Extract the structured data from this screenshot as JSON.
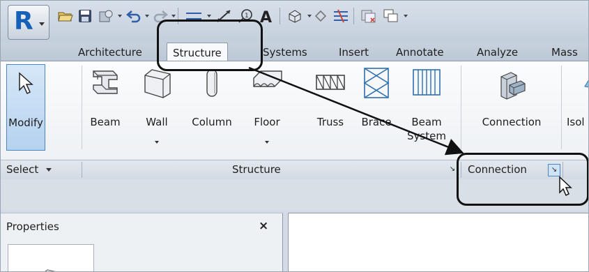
{
  "app": {
    "logo_letter": "R"
  },
  "quick_access": {
    "icons": [
      "open-icon",
      "save-icon",
      "sync-icon",
      "undo-icon",
      "redo-icon",
      "measure-icon",
      "dimension-icon",
      "tag-icon",
      "text-icon",
      "3d-view-icon",
      "section-icon",
      "thin-lines-icon",
      "close-hidden-icon",
      "switch-windows-icon"
    ]
  },
  "tabs": [
    {
      "label": "Architecture"
    },
    {
      "label": "Structure",
      "active": true
    },
    {
      "label": "Systems"
    },
    {
      "label": "Insert"
    },
    {
      "label": "Annotate"
    },
    {
      "label": "Analyze"
    },
    {
      "label": "Mass"
    }
  ],
  "ribbon": {
    "select_panel": {
      "modify_label": "Modify"
    },
    "structure_panel": {
      "beam": "Beam",
      "wall": "Wall",
      "column": "Column",
      "floor": "Floor",
      "truss": "Truss",
      "brace": "Brace",
      "beam_system_line1": "Beam",
      "beam_system_line2": "System"
    },
    "connection_panel": {
      "connection": "Connection"
    },
    "next_button": "Isol"
  },
  "panel_titles": {
    "select": "Select",
    "structure": "Structure",
    "connection": "Connection",
    "launcher_glyph": "↘"
  },
  "properties": {
    "title": "Properties",
    "close": "×"
  },
  "colors": {
    "accent": "#4a86c5",
    "modify_active_bg": "#c4dcf3",
    "ribbon_bg": "#f4f6f9",
    "callout": "#111111"
  }
}
